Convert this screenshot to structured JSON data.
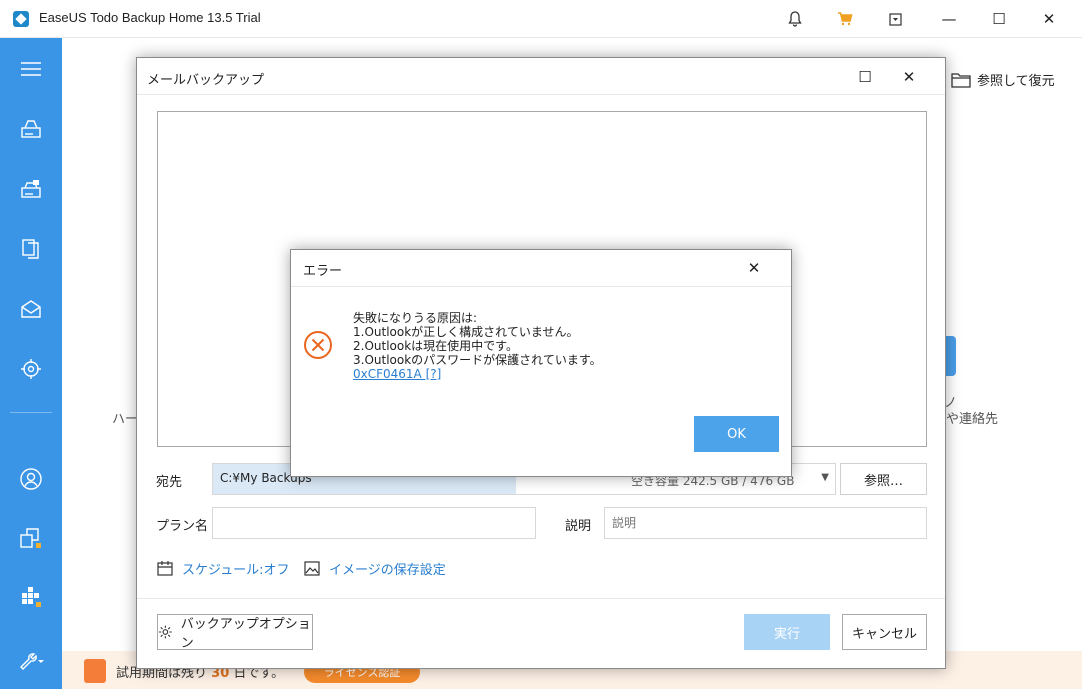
{
  "app": {
    "title": "EaseUS Todo Backup Home 13.5 Trial",
    "accent": "#3b95e6"
  },
  "titlebar": {
    "icons": [
      "bell-icon",
      "cart-icon",
      "dropdown-menu-icon"
    ],
    "window_buttons": {
      "minimize": "—",
      "maximize": "☐",
      "close": "✕"
    }
  },
  "sidebar": {
    "items": [
      "menu-icon",
      "disk-backup-icon",
      "system-backup-icon",
      "file-backup-icon",
      "mail-backup-icon",
      "smart-backup-icon",
      "account-icon",
      "clone-icon",
      "tools-grid-icon",
      "wrench-icon"
    ]
  },
  "background": {
    "browse_restore": "参照して復元",
    "left_label": "ハー",
    "right_label": "や連絡先",
    "right_label_top": "ノ"
  },
  "trial": {
    "prefix": "試用期間は残り",
    "days": "30",
    "suffix": "日です。",
    "license_button": "ライセンス認証"
  },
  "mail_dialog": {
    "title": "メールバックアップ",
    "maximize": "☐",
    "close": "✕",
    "destination_label": "宛先",
    "destination_value": "C:¥My Backups",
    "destination_capacity": "空き容量 242.5 GB / 476 GB",
    "browse_button": "参照…",
    "plan_label": "プラン名",
    "plan_value": "",
    "description_label": "説明",
    "description_placeholder": "説明",
    "schedule_link": "スケジュール:オフ",
    "image_settings_link": "イメージの保存設定",
    "backup_options_button": "バックアップオプション",
    "run_button": "実行",
    "cancel_button": "キャンセル"
  },
  "error_dialog": {
    "title": "エラー",
    "close": "✕",
    "message_lines": [
      "失敗になりうる原因は:",
      "1.Outlookが正しく構成されていません。",
      "2.Outlookは現在使用中です。",
      "3.Outlookのパスワードが保護されています。"
    ],
    "error_code": "0xCF0461A [?]",
    "ok_button": "OK"
  }
}
